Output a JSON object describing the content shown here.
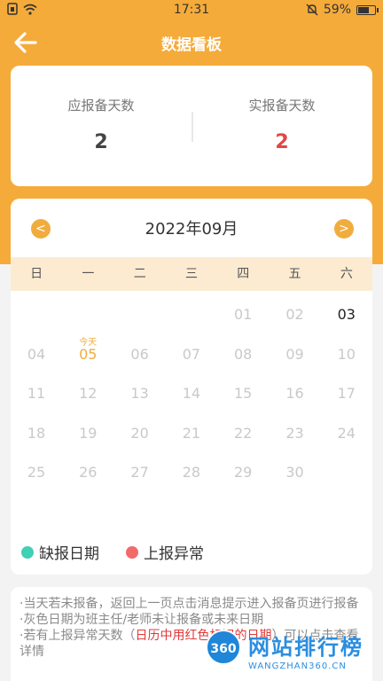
{
  "status_bar": {
    "time": "17:31",
    "battery": "59%",
    "left_icons": [
      "sim-icon",
      "wifi-icon"
    ],
    "right_icons": [
      "mute-bell-icon",
      "battery-icon"
    ],
    "battery_level": 0.59
  },
  "header": {
    "title": "数据看板"
  },
  "stats": {
    "expected_label": "应报备天数",
    "expected_value": "2",
    "actual_label": "实报备天数",
    "actual_value": "2"
  },
  "calendar": {
    "month": "2022年09月",
    "prev_icon": "<",
    "next_icon": ">",
    "weekdays": [
      "日",
      "一",
      "二",
      "三",
      "四",
      "五",
      "六"
    ],
    "today_tag": "今天",
    "days": [
      "01",
      "02",
      "03",
      "04",
      "05",
      "06",
      "07",
      "08",
      "09",
      "10",
      "11",
      "12",
      "13",
      "14",
      "15",
      "16",
      "17",
      "18",
      "19",
      "20",
      "21",
      "22",
      "23",
      "24",
      "25",
      "26",
      "27",
      "28",
      "29",
      "30"
    ]
  },
  "legend": {
    "missing_label": "缺报日期",
    "missing_color": "#3fd0b6",
    "abnormal_label": "上报异常",
    "abnormal_color": "#f26b6b"
  },
  "notes": {
    "line1": "·当天若未报备，返回上一页点击消息提示进入报备页进行报备",
    "line2": "·灰色日期为班主任/老师未让报备或未来日期",
    "line3_prefix": "·若有上报异常天数（",
    "line3_red": "日历中用红色标识的日期",
    "line3_suffix": "）可以点击查看详情"
  },
  "watermark": {
    "badge": "360",
    "title": "网站排行榜",
    "subtitle": "WANGZHAN360.CN"
  }
}
